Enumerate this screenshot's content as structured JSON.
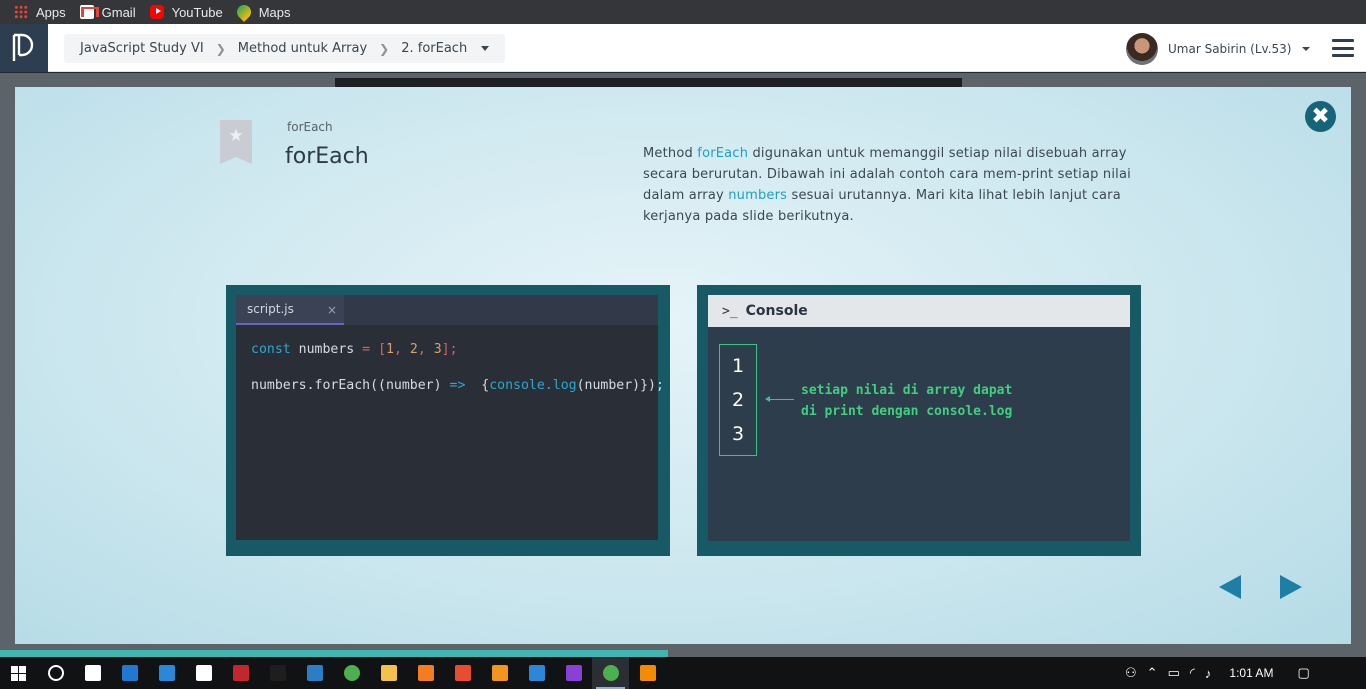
{
  "bookmarks": [
    {
      "label": "Apps",
      "icon": "apps-grid-icon"
    },
    {
      "label": "Gmail",
      "icon": "gmail-icon"
    },
    {
      "label": "YouTube",
      "icon": "youtube-icon"
    },
    {
      "label": "Maps",
      "icon": "maps-icon"
    }
  ],
  "header": {
    "breadcrumb": [
      "JavaScript Study VI",
      "Method untuk Array",
      "2. forEach"
    ],
    "user_name": "Umar Sabirin (Lv.53)"
  },
  "modal": {
    "subtitle": "forEach",
    "title": "forEach",
    "description": {
      "p1": "Method ",
      "h1": "forEach",
      "p2": " digunakan untuk memanggil setiap nilai disebuah array secara berurutan. Dibawah ini adalah contoh cara mem-print setiap nilai dalam array ",
      "h2": "numbers",
      "p3": " sesuai urutannya. Mari kita lihat lebih lanjut cara kerjanya pada slide berikutnya."
    },
    "editor": {
      "tab_name": "script.js",
      "tab_close": "×",
      "line1": {
        "kw": "const",
        "name": " numbers ",
        "op": "=",
        "open": " [",
        "n1": "1",
        "c1": ", ",
        "n2": "2",
        "c2": ", ",
        "n3": "3",
        "close": "];"
      },
      "line2": {
        "a": "numbers.forEach((number) ",
        "arrow": "=>",
        "b": "  {",
        "fn1": "console",
        "dot": ".",
        "fn2": "log",
        "c": "(number)});"
      }
    },
    "console": {
      "title": "Console",
      "prompt": ">_",
      "outputs": [
        "1",
        "2",
        "3"
      ],
      "annotation_line1": "setiap nilai di array dapat",
      "annotation_line2": "di print dengan console.log"
    },
    "close_symbol": "✖"
  },
  "taskbar": {
    "time": "1:01 AM",
    "apps": [
      {
        "name": "file-explorer-taskview-icon",
        "color": "#ffffff"
      },
      {
        "name": "edge-icon",
        "color": "#1f78d1"
      },
      {
        "name": "mail-icon",
        "color": "#2b88d8"
      },
      {
        "name": "store-icon",
        "color": "#ffffff"
      },
      {
        "name": "filezilla-icon",
        "color": "#c1272d"
      },
      {
        "name": "pycharm-icon",
        "color": "#1e1e1e"
      },
      {
        "name": "vscode-icon",
        "color": "#2b7ec6"
      },
      {
        "name": "chrome-icon",
        "color": "#4caf50"
      },
      {
        "name": "folder-icon",
        "color": "#f4c14a"
      },
      {
        "name": "xampp-icon",
        "color": "#f37e21"
      },
      {
        "name": "git-icon",
        "color": "#e84d31"
      },
      {
        "name": "sublime-icon",
        "color": "#f2951c"
      },
      {
        "name": "maps-app-icon",
        "color": "#2b88d8"
      },
      {
        "name": "phpstorm-icon",
        "color": "#8a3fd6"
      },
      {
        "name": "chrome-active-icon",
        "color": "#4caf50"
      },
      {
        "name": "vlc-icon",
        "color": "#f48b00"
      }
    ]
  }
}
